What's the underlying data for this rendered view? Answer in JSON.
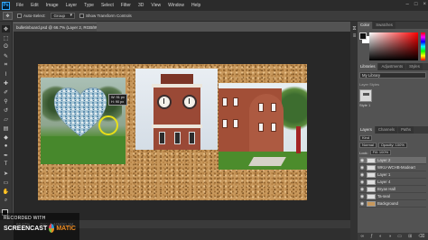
{
  "menubar": {
    "logo": "Ps",
    "items": [
      "File",
      "Edit",
      "Image",
      "Layer",
      "Type",
      "Select",
      "Filter",
      "3D",
      "View",
      "Window",
      "Help"
    ],
    "window_controls": [
      "–",
      "□",
      "×"
    ]
  },
  "options_bar": {
    "auto_select_label": "Auto-Select:",
    "auto_select_target": "Group",
    "show_transform_label": "Show Transform Controls"
  },
  "tools": [
    "move",
    "marquee",
    "lasso",
    "quick-select",
    "crop",
    "eyedropper",
    "healing",
    "brush",
    "clone-stamp",
    "history-brush",
    "eraser",
    "gradient",
    "blur",
    "dodge",
    "pen",
    "type",
    "path-select",
    "shape",
    "hand",
    "zoom"
  ],
  "document": {
    "tab_title": "bulletinboard.psd @ 66.7% (Layer 2, RGB/8#) *",
    "readout": [
      "W: 91 px",
      "H: 90 px"
    ],
    "zoom_status": "66.67%",
    "doc_info": "Doc: 3.44M/20.1M"
  },
  "watermark": {
    "recorded_with": "RECORDED WITH",
    "brand_left": "SCREENCAST",
    "brand_sep": "•",
    "brand_right": "MATIC"
  },
  "panels": {
    "color_tabs": [
      "Color",
      "Swatches"
    ],
    "library_tabs": [
      "Libraries",
      "Adjustments",
      "Styles"
    ],
    "library_dropdown": "My Library",
    "library_section": "Layer Styles",
    "library_item": "Style 1",
    "layers_tabs": [
      "Layers",
      "Channels",
      "Paths"
    ],
    "kind_label": "Kind",
    "blend_mode": "Normal",
    "opacity_label": "Opacity: 100%",
    "lock_label": "Lock:",
    "fill_label": "Fill: 100%",
    "layers": [
      {
        "name": "Layer 2",
        "selected": true,
        "thumb": "light"
      },
      {
        "name": "WKU-WCHB-Modeart",
        "selected": false,
        "thumb": "light"
      },
      {
        "name": "Layer 1",
        "selected": false,
        "thumb": "light"
      },
      {
        "name": "Layer 4",
        "selected": false,
        "thumb": "light"
      },
      {
        "name": "Bryan Hall",
        "selected": false,
        "thumb": "light"
      },
      {
        "name": "Ta-seal",
        "selected": false,
        "thumb": "light"
      },
      {
        "name": "Background",
        "selected": false,
        "thumb": "cork"
      }
    ],
    "footer_icons": [
      "link-icon",
      "fx-icon",
      "mask-icon",
      "adjustment-icon",
      "folder-icon",
      "new-layer-icon",
      "trash-icon"
    ]
  },
  "colors": {
    "corkboard": "#c8985c",
    "selection_ring": "#e8df18",
    "ps_blue": "#31a8ff"
  }
}
